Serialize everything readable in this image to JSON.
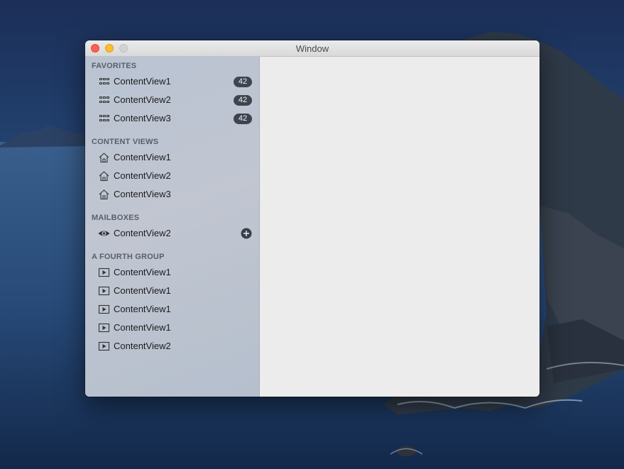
{
  "window": {
    "title": "Window"
  },
  "sidebar": {
    "groups": [
      {
        "header": "FAVORITES",
        "icon": "grid-icon",
        "items": [
          {
            "label": "ContentView1",
            "badge": "42"
          },
          {
            "label": "ContentView2",
            "badge": "42"
          },
          {
            "label": "ContentView3",
            "badge": "42"
          }
        ]
      },
      {
        "header": "CONTENT VIEWS",
        "icon": "house-icon",
        "items": [
          {
            "label": "ContentView1"
          },
          {
            "label": "ContentView2"
          },
          {
            "label": "ContentView3"
          }
        ]
      },
      {
        "header": "MAILBOXES",
        "icon": "eye-icon",
        "items": [
          {
            "label": "ContentView2",
            "action": "plus-circle-icon"
          }
        ]
      },
      {
        "header": "A FOURTH GROUP",
        "icon": "play-box-icon",
        "items": [
          {
            "label": "ContentView1"
          },
          {
            "label": "ContentView1"
          },
          {
            "label": "ContentView1"
          },
          {
            "label": "ContentView1"
          },
          {
            "label": "ContentView2"
          }
        ]
      }
    ]
  },
  "colors": {
    "badge_bg": "#3d4550",
    "close": "#fe5f57",
    "minimize": "#febc2e",
    "zoom_disabled": "#d3d3d3"
  }
}
